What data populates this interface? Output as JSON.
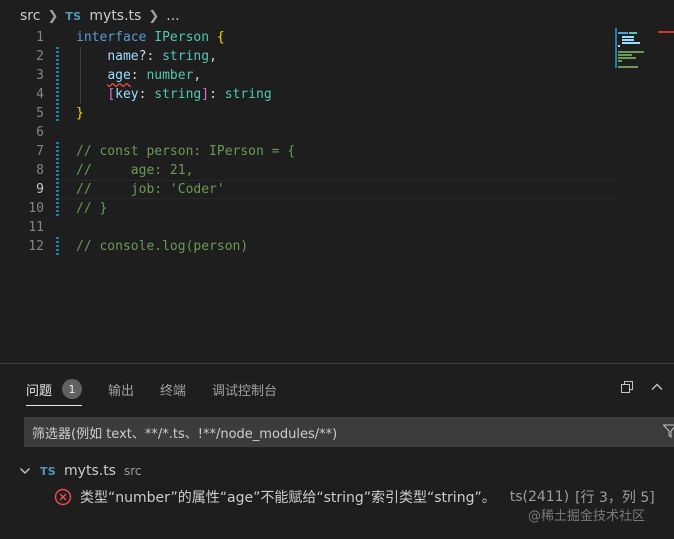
{
  "breadcrumb": {
    "folder": "src",
    "file_badge": "TS",
    "file": "myts.ts",
    "ellipsis": "..."
  },
  "editor": {
    "line_numbers": [
      "1",
      "2",
      "3",
      "4",
      "5",
      "6",
      "7",
      "8",
      "9",
      "10",
      "11",
      "12"
    ],
    "active_line": "9",
    "lines": {
      "l1": {
        "kw": "interface",
        "name": "IPerson",
        "brace": "{"
      },
      "l2": {
        "indent": "    ",
        "prop": "name",
        "punct": "?: ",
        "type": "string",
        "end": ","
      },
      "l3": {
        "indent": "    ",
        "prop": "age",
        "punct": ": ",
        "type": "number",
        "end": ","
      },
      "l4": {
        "indent": "    ",
        "open": "[",
        "prop": "key",
        "punct": ": ",
        "type": "string",
        "close": "]",
        "punct2": ": ",
        "type2": "string"
      },
      "l5": {
        "brace": "}"
      },
      "l7": "// const person: IPerson = {",
      "l8": "//     age: 21,",
      "l9": "//     job: 'Coder'",
      "l10": "// }",
      "l12": "// console.log(person)"
    }
  },
  "panel": {
    "tabs": [
      {
        "label": "问题",
        "count": "1"
      },
      {
        "label": "输出"
      },
      {
        "label": "终端"
      },
      {
        "label": "调试控制台"
      }
    ],
    "filter_placeholder": "筛选器(例如 text、**/*.ts、!**/node_modules/**)",
    "file_group": {
      "badge": "TS",
      "name": "myts.ts",
      "dir": "src"
    },
    "problem": {
      "message": "类型“number”的属性“age”不能赋给“string”索引类型“string”。",
      "source": "ts(2411)",
      "location": "[行 3，列 5]"
    },
    "watermark": "@稀土掘金技术社区"
  },
  "colors": {
    "background": "#1e1e1e",
    "keyword": "#569cd6",
    "type": "#4ec9b0",
    "property": "#9cdcfe",
    "comment": "#6a9955",
    "error": "#f14c4c",
    "modified_marker": "#1b81a8"
  },
  "icons": [
    "chevron-right-icon",
    "ts-file-icon",
    "maximize-panel-icon",
    "chevron-up-icon",
    "filter-icon",
    "chevron-down-icon",
    "error-icon"
  ]
}
